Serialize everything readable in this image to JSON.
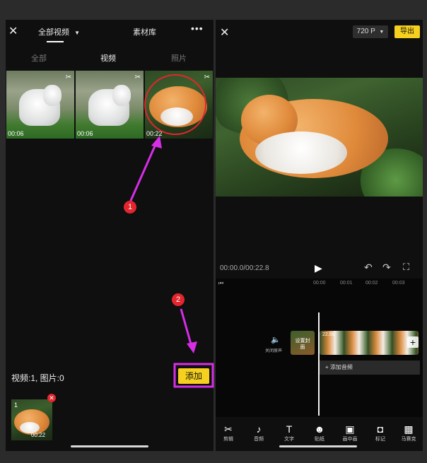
{
  "left": {
    "header": {
      "title": "全部视频",
      "library_tab": "素材库"
    },
    "filter_tabs": [
      "全部",
      "视频",
      "照片"
    ],
    "thumbnails": [
      {
        "duration": "00:06",
        "subject": "goat"
      },
      {
        "duration": "00:06",
        "subject": "goat"
      },
      {
        "duration": "00:22",
        "subject": "cat"
      }
    ],
    "selection_summary": "视频:1, 图片:0",
    "add_button": "添加",
    "selected_item": {
      "index": "1",
      "duration": "00:22"
    }
  },
  "right": {
    "resolution": "720 P",
    "export_button": "导出",
    "timecode": "00:00.0/00:22.8",
    "ruler_ticks": [
      "00:00",
      "00:01",
      "00:02",
      "00:03"
    ],
    "mute_label": "关闭原声",
    "cover_label": "设置封面",
    "clip_duration": "22.0s",
    "add_audio": "+ 添加音频",
    "toolbar": [
      {
        "icon": "scissors-icon",
        "glyph": "✂",
        "label": "剪辑"
      },
      {
        "icon": "music-icon",
        "glyph": "♪",
        "label": "音频"
      },
      {
        "icon": "text-icon",
        "glyph": "T",
        "label": "文字"
      },
      {
        "icon": "sticker-icon",
        "glyph": "☻",
        "label": "贴纸"
      },
      {
        "icon": "pip-icon",
        "glyph": "▣",
        "label": "画中画"
      },
      {
        "icon": "marker-icon",
        "glyph": "◘",
        "label": "标记"
      },
      {
        "icon": "mosaic-icon",
        "glyph": "▩",
        "label": "马赛克"
      }
    ]
  },
  "annotations": {
    "step1": "1",
    "step2": "2"
  },
  "colors": {
    "accent_yellow": "#f5d01e",
    "highlight_magenta": "#d52ee6",
    "marker_red": "#e3262d"
  }
}
